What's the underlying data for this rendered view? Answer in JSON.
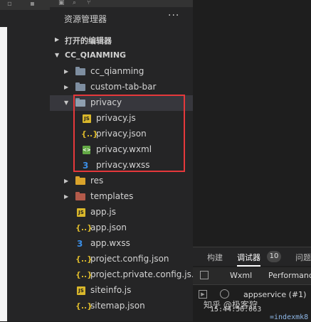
{
  "explorer": {
    "title": "资源管理器",
    "more": "···",
    "open_editors": "打开的编辑器",
    "project_name": "CC_QIANMING",
    "items": [
      {
        "label": "cc_qianming",
        "type": "folder"
      },
      {
        "label": "custom-tab-bar",
        "type": "folder"
      },
      {
        "label": "privacy",
        "type": "folder-open"
      },
      {
        "label": "privacy.js",
        "type": "js"
      },
      {
        "label": "privacy.json",
        "type": "json"
      },
      {
        "label": "privacy.wxml",
        "type": "wxml"
      },
      {
        "label": "privacy.wxss",
        "type": "wxss"
      },
      {
        "label": "res",
        "type": "folder"
      },
      {
        "label": "templates",
        "type": "folder"
      },
      {
        "label": "app.js",
        "type": "js"
      },
      {
        "label": "app.json",
        "type": "json"
      },
      {
        "label": "app.wxss",
        "type": "wxss"
      },
      {
        "label": "project.config.json",
        "type": "json"
      },
      {
        "label": "project.private.config.js...",
        "type": "json"
      },
      {
        "label": "siteinfo.js",
        "type": "js"
      },
      {
        "label": "sitemap.json",
        "type": "json"
      }
    ]
  },
  "icons": {
    "js_badge": "JS",
    "json_badge": "{..}",
    "wxml_badge": "<>",
    "wxss_badge": "3"
  },
  "debug": {
    "tab_build": "构建",
    "tab_debugger": "调试器",
    "tab_count": "10",
    "tab_issues": "问题",
    "subtab_wxml": "Wxml",
    "subtab_performance": "Performance",
    "context": "appservice (#1)",
    "log_time": "15:44:56.063",
    "log_text": "=indexmk8"
  },
  "watermark": "知乎 @极客狩",
  "colors": {
    "highlight": "#e5383b",
    "js": "#d9b72b",
    "wxml": "#63a845",
    "wxss": "#3a8ee6"
  }
}
